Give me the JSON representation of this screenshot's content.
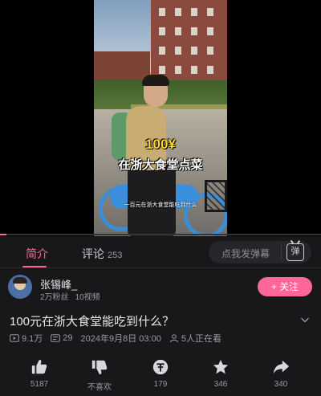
{
  "video": {
    "caption_price": "100¥",
    "caption_main": "在浙大食堂点菜",
    "caption_sub": "一百元在浙大食堂能吃到什么",
    "progress": 0.02
  },
  "tabs": {
    "intro_label": "简介",
    "comments_label": "评论",
    "comments_count": "253"
  },
  "danmaku": {
    "placeholder": "点我发弹幕",
    "button_label": "弹"
  },
  "uploader": {
    "name": "张锡峰_",
    "followers": "2万粉丝",
    "videos": "10视频",
    "follow_label": "+ 关注"
  },
  "title": "100元在浙大食堂能吃到什么？",
  "meta": {
    "plays": "9.1万",
    "danmaku_count": "29",
    "datetime": "2024年9月8日 03:00",
    "watching": "5人正在看"
  },
  "actions": [
    {
      "icon": "thumbs-up-icon",
      "label": "5187"
    },
    {
      "icon": "thumbs-down-icon",
      "label": "不喜欢"
    },
    {
      "icon": "coin-icon",
      "label": "179"
    },
    {
      "icon": "star-icon",
      "label": "346"
    },
    {
      "icon": "share-icon",
      "label": "340"
    }
  ],
  "colors": {
    "accent": "#ff6699",
    "background": "#18181b",
    "text_secondary": "#9a9aa0"
  }
}
